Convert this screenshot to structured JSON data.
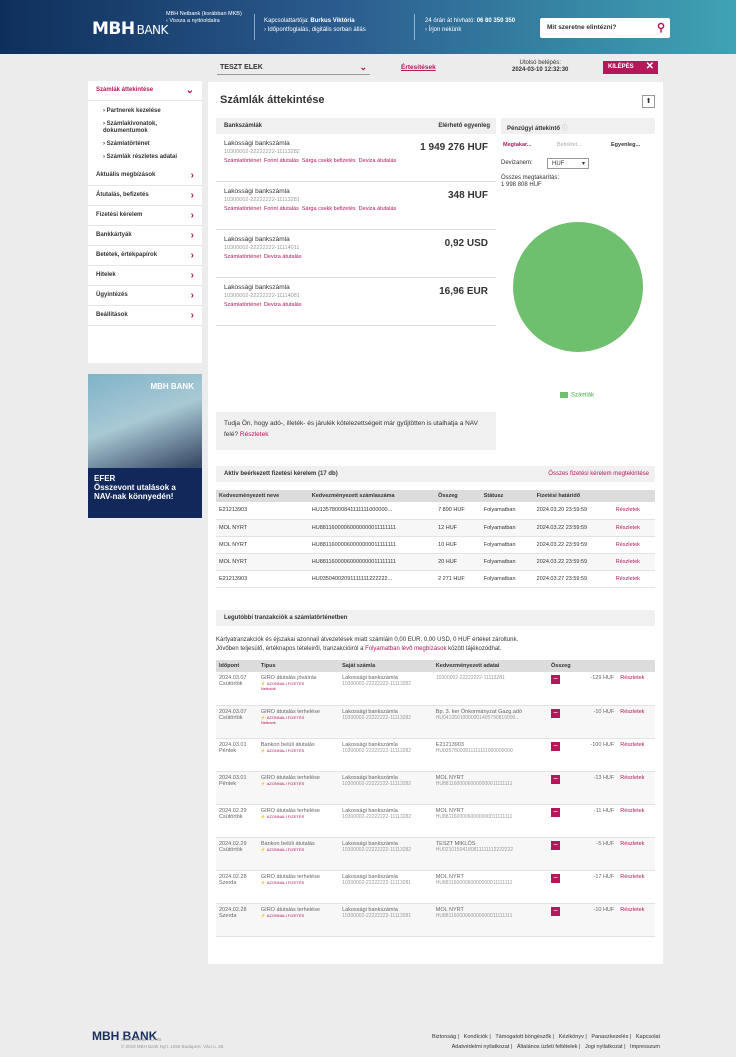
{
  "header": {
    "logo": "MBH",
    "logo_bank": "BANK",
    "nb_title": "MBH Netbank (korábban MKB)",
    "nb_back": "Vissza a nyitóoldalra",
    "contact_label": "Kapcsolattartója:",
    "contact_name": "Burkus Viktória",
    "contact_links": "Időpontfoglalás, digitális sorban állás",
    "phone_label": "24 órán át hívható:",
    "phone": "06 80 350 350",
    "contact_us": "Írjon nekünk",
    "search_placeholder": "Mit szeretne elintézni?"
  },
  "topbar": {
    "user": "TESZT ELEK",
    "notifications": "Értesítések",
    "last_login_label": "Utolsó belépés:",
    "last_login": "2024-03-10 12:32:30",
    "exit": "KILÉPÉS"
  },
  "sidebar": {
    "active": "Számlák áttekintése",
    "subitems": [
      "Partnerek kezelése",
      "Számlakivonatok, dokumentumok",
      "Számlatörténet",
      "Számlák részletes adatai"
    ],
    "items": [
      "Aktuális megbízások",
      "Átutalás, befizetés",
      "Fizetési kérelem",
      "Bankkártyák",
      "Betétek, értékpapírok",
      "Hitelek",
      "Ügyintézés",
      "Beállítások"
    ]
  },
  "ad": {
    "logo": "MBH BANK",
    "line1": "EFER",
    "line2": "Összevont utalások a NAV-nak könnyedén!"
  },
  "main": {
    "title": "Számlák áttekintése",
    "col_accounts": "Bankszámlák",
    "col_balance": "Elérhető egyenleg",
    "accounts": [
      {
        "name": "Lakossági bankszámla",
        "number": "10300002-22222222-11113282",
        "balance": "1 949 276 HUF",
        "links": [
          "Számlatörténet",
          "Forint átutalás",
          "Sárga csekk befizetés",
          "Deviza átutalás"
        ]
      },
      {
        "name": "Lakossági bankszámla",
        "number": "10300002-22222222-11113281",
        "balance": "348 HUF",
        "links": [
          "Számlatörténet",
          "Forint átutalás",
          "Sárga csekk befizetés",
          "Deviza átutalás"
        ]
      },
      {
        "name": "Lakossági bankszámla",
        "number": "10300002-22222222-11114011",
        "balance": "0,92 USD",
        "links": [
          "Számlatörténet",
          "Deviza átutalás"
        ]
      },
      {
        "name": "Lakossági bankszámla",
        "number": "10300002-22222222-11114081",
        "balance": "16,96 EUR",
        "links": [
          "Számlatörténet",
          "Deviza átutalás"
        ]
      }
    ],
    "fin": {
      "title": "Pénzügyi áttekintő",
      "tabs": [
        "Megtakar...",
        "Befektet...",
        "Egyenleg..."
      ],
      "currency_label": "Devizanem:",
      "currency": "HUF",
      "total_label": "Összes megtakarítás:",
      "total": "1 998 808 HUF",
      "legend": "Számlák"
    },
    "tax_note": "Tudja Ön, hogy adó-, illeték- és járulék kötelezettségeit már gyűjtötten is utalhatja a NAV felé?",
    "tax_link": "Részletek"
  },
  "requests": {
    "title": "Aktív beérkezett fizetési kérelem (17 db)",
    "all_link": "Összes fizetési kérelem megtekintése",
    "headers": [
      "Kedvezményezett neve",
      "Kedvezményezett számlaszáma",
      "Összeg",
      "Státusz",
      "Fizetési határidő",
      ""
    ],
    "rows": [
      [
        "E21213903",
        "HU13578000841111111000000...",
        "7 890 HUF",
        "Folyamatban",
        "2024.03.20 23:59:59",
        "Részletek"
      ],
      [
        "MOL NYRT",
        "HU88116000060000000011111111",
        "12 HUF",
        "Folyamatban",
        "2024.03.22 23:59:59",
        "Részletek"
      ],
      [
        "MOL NYRT",
        "HU88116000060000000011111111",
        "10 HUF",
        "Folyamatban",
        "2024.03.22 23:59:59",
        "Részletek"
      ],
      [
        "MOL NYRT",
        "HU88116000060000000011111111",
        "20 HUF",
        "Folyamatban",
        "2024.03.22 23:59:59",
        "Részletek"
      ],
      [
        "E21213903",
        "HU03504002091111111222222...",
        "2 271 HUF",
        "Folyamatban",
        "2024.03.27 23:59:59",
        "Részletek"
      ]
    ]
  },
  "transactions": {
    "title": "Legutóbbi tranzakciók a számlatörténetben",
    "note1": "Kártyatranzakciók és éjszakai azonnali átvezetések miatt számláin 0,00 EUR, 0,00 USD, 0 HUF értéket zároltunk.",
    "note2a": "Jövőben teljesülő, értéknapos tételeiről, tranzakcióiról a ",
    "note2link": "Folyamatban lévő megbízások",
    "note2b": " között tájékozódhat.",
    "headers": [
      "Időpont",
      "Típus",
      "Saját számla",
      "Kedvezményezett adatai",
      "Összeg",
      "",
      ""
    ],
    "instant": "AZONNALI FIZETÉS",
    "rows": [
      {
        "date": "2024.03.07",
        "day": "Csütörtök",
        "type": "GIRO átutalás jóváírás",
        "tag": "Netbank",
        "own": "Lakossági bankszámla",
        "own_no": "10300002-22222222-11113282",
        "ben": "",
        "ben_no": "10300002-22222222-11113281",
        "amount": "-129 HUF",
        "link": "Részletek"
      },
      {
        "date": "2024.03.07",
        "day": "Csütörtök",
        "type": "GIRO átutalás terhelése",
        "tag": "Netbank",
        "own": "Lakossági bankszámla",
        "own_no": "10300002-22222222-11113282",
        "ben": "Bp. 3. ker Önkormányzat Gazg.adó",
        "ben_no": "HU04135010000001405790810000...",
        "amount": "-10 HUF",
        "link": "Részletek"
      },
      {
        "date": "2024.03.01",
        "day": "Péntek",
        "type": "Bankon belüli átutalás",
        "tag": "",
        "own": "Lakossági bankszámla",
        "own_no": "10300002-22222222-11113282",
        "ben": "E21213903",
        "ben_no": "HU03578000811111111000000000",
        "amount": "-100 HUF",
        "link": "Részletek"
      },
      {
        "date": "2024.03.01",
        "day": "Péntek",
        "type": "GIRO átutalás terhelése",
        "tag": "",
        "own": "Lakossági bankszámla",
        "own_no": "10300002-22222222-11113282",
        "ben": "MOL NYRT",
        "ben_no": "HU88116000060000000011111111",
        "amount": "-13 HUF",
        "link": "Részletek"
      },
      {
        "date": "2024.02.29",
        "day": "Csütörtök",
        "type": "GIRO átutalás terhelése",
        "tag": "",
        "own": "Lakossági bankszámla",
        "own_no": "10300002-22222222-11113282",
        "ben": "MOL NYRT",
        "ben_no": "HU88116000060000000011111111",
        "amount": "-11 HUF",
        "link": "Részletek"
      },
      {
        "date": "2024.02.29",
        "day": "Csütörtök",
        "type": "Bankon belüli átutalás",
        "tag": "",
        "own": "Lakossági bankszámla",
        "own_no": "10300002-22222222-11113282",
        "ben": "TESZT MIKLÓS",
        "ben_no": "HU02101504180811111112222222",
        "amount": "-5 HUF",
        "link": "Részletek"
      },
      {
        "date": "2024.02.28",
        "day": "Szerda",
        "type": "GIRO átutalás terhelése",
        "tag": "",
        "own": "Lakossági bankszámla",
        "own_no": "10300002-22222222-11113281",
        "ben": "MOL NYRT",
        "ben_no": "HU88116000060000000011111111",
        "amount": "-17 HUF",
        "link": "Részletek"
      },
      {
        "date": "2024.02.28",
        "day": "Szerda",
        "type": "GIRO átutalás terhelése",
        "tag": "",
        "own": "Lakossági bankszámla",
        "own_no": "10300002-22222222-11113281",
        "ben": "MOL NYRT",
        "ben_no": "HU88116000060000000011111111",
        "amount": "-10 HUF",
        "link": "Részletek"
      }
    ]
  },
  "footer": {
    "logo": "MBH BANK",
    "info1": "Swift: MKKB HU HB",
    "info2": "© 2018 MBH Bank Nyrt. 1056 Budapest, Váci u. 38.",
    "links1": [
      "Biztonság",
      "Kondíciók",
      "Támogatott böngészők",
      "Kézikönyv",
      "Panaszkezelés",
      "Kapcsolat"
    ],
    "links2": [
      "Adatvédelmi nyilatkozat",
      "Általános üzleti feltételek",
      "Jogi nyilatkozat",
      "Impresszum"
    ]
  },
  "colors": {
    "accent": "#b5175b",
    "header_dark": "#0e2f5b",
    "header_light": "#3fa3b4",
    "chart": "#6ec06e"
  }
}
